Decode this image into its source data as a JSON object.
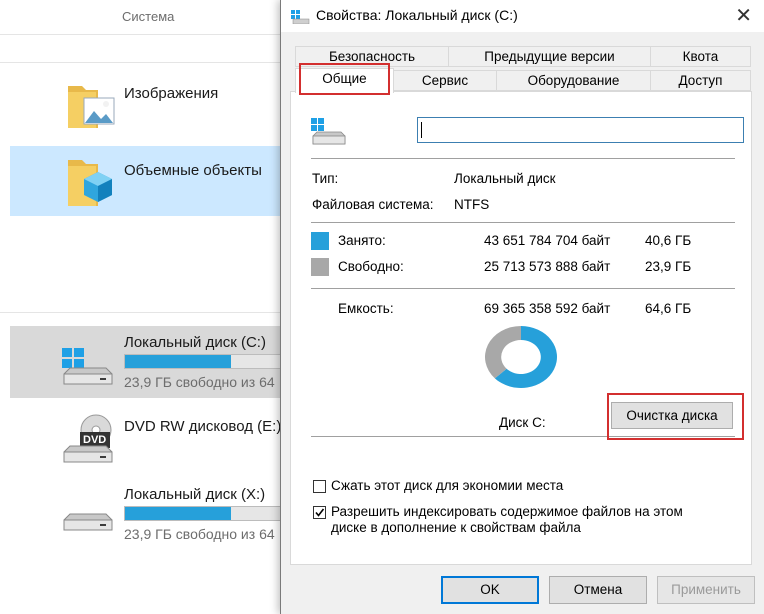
{
  "explorer": {
    "column_header": "Система",
    "items": [
      {
        "label": "Изображения",
        "icon": "pictures-folder-icon"
      },
      {
        "label": "Объемные объекты",
        "icon": "3d-objects-folder-icon"
      }
    ],
    "drives": [
      {
        "label": "Локальный диск (C:)",
        "free": "23,9 ГБ свободно из 64",
        "used_fraction": 0.63
      },
      {
        "label": "DVD RW дисковод (E:)",
        "icon_text": "DVD"
      },
      {
        "label": "Локальный диск (X:)",
        "free": "23,9 ГБ свободно из 64",
        "used_fraction": 0.63
      }
    ]
  },
  "dialog": {
    "title": "Свойства: Локальный диск (C:)",
    "close": "✕",
    "tabs_row1": [
      "Безопасность",
      "Предыдущие версии",
      "Квота"
    ],
    "tabs_row2": [
      "Общие",
      "Сервис",
      "Оборудование",
      "Доступ"
    ],
    "active_tab": "Общие",
    "name_value": "",
    "type_label": "Тип:",
    "type_value": "Локальный диск",
    "fs_label": "Файловая система:",
    "fs_value": "NTFS",
    "used_label": "Занято:",
    "used_bytes": "43 651 784 704 байт",
    "used_gb": "40,6 ГБ",
    "free_label": "Свободно:",
    "free_bytes": "25 713 573 888 байт",
    "free_gb": "23,9 ГБ",
    "capacity_label": "Емкость:",
    "capacity_bytes": "69 365 358 592 байт",
    "capacity_gb": "64,6 ГБ",
    "disk_label": "Диск C:",
    "cleanup_button": "Очистка диска",
    "compress_label": "Сжать этот диск для экономии места",
    "compress_checked": false,
    "index_label_line1": "Разрешить индексировать содержимое файлов на этом",
    "index_label_line2": "диске в дополнение к свойствам файла",
    "index_checked": true,
    "ok": "OK",
    "cancel": "Отмена",
    "apply": "Применить",
    "colors": {
      "used": "#26a0da",
      "free": "#a8a8a8",
      "highlight": "#d32f2f"
    },
    "used_fraction": 0.6293
  }
}
